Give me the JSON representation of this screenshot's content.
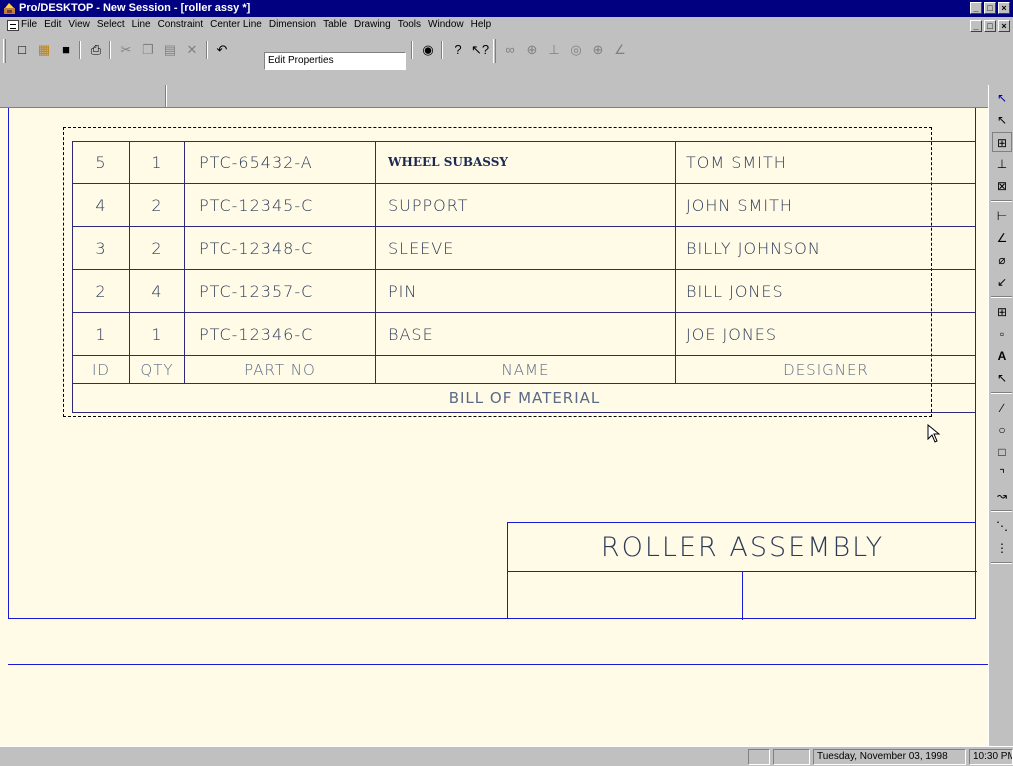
{
  "window": {
    "title": "Pro/DESKTOP - New Session - [roller assy *]",
    "controls": [
      "_",
      "□",
      "×"
    ]
  },
  "menubar": {
    "items": [
      "File",
      "Edit",
      "View",
      "Select",
      "Line",
      "Constraint",
      "Center Line",
      "Dimension",
      "Table",
      "Drawing",
      "Tools",
      "Window",
      "Help"
    ]
  },
  "toolbar": {
    "command_field": "Edit Properties"
  },
  "bom": {
    "rows": [
      {
        "id": "5",
        "qty": "1",
        "part_no": "PTC-65432-A",
        "name": "WHEEL SUBASSY",
        "designer": "TOM SMITH"
      },
      {
        "id": "4",
        "qty": "2",
        "part_no": "PTC-12345-C",
        "name": "SUPPORT",
        "designer": "JOHN SMITH"
      },
      {
        "id": "3",
        "qty": "2",
        "part_no": "PTC-12348-C",
        "name": "SLEEVE",
        "designer": "BILLY JOHNSON"
      },
      {
        "id": "2",
        "qty": "4",
        "part_no": "PTC-12357-C",
        "name": "PIN",
        "designer": "BILL JONES"
      },
      {
        "id": "1",
        "qty": "1",
        "part_no": "PTC-12346-C",
        "name": "BASE",
        "designer": "JOE JONES"
      }
    ],
    "headers": {
      "id": "ID",
      "qty": "QTY",
      "part_no": "PART NO",
      "name": "NAME",
      "designer": "DESIGNER"
    },
    "caption": "BILL OF MATERIAL"
  },
  "title_block": {
    "title": "ROLLER ASSEMBLY"
  },
  "statusbar": {
    "date": "Tuesday, November 03, 1998",
    "time": "10:30 PM"
  }
}
